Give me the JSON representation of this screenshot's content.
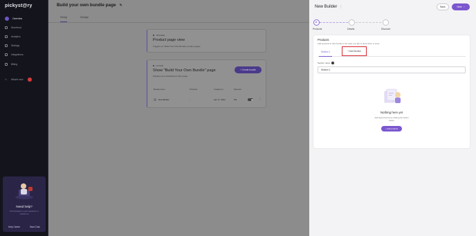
{
  "sidebar": {
    "logo": "pickyst@ry",
    "items": [
      {
        "label": "Overview",
        "icon": "home-icon",
        "active": true
      },
      {
        "label": "Storefront",
        "icon": "store-icon"
      },
      {
        "label": "Analytics",
        "icon": "chart-icon"
      },
      {
        "label": "Settings",
        "icon": "gear-icon"
      },
      {
        "label": "Integrations",
        "icon": "plug-icon"
      },
      {
        "label": "Billing",
        "icon": "card-icon"
      },
      {
        "label": "What's new",
        "icon": "sparkle-icon",
        "badge": true
      }
    ],
    "help": {
      "title": "Need help?",
      "sub": "Find answers to your questions or contact us",
      "link1": "Help Center",
      "link2": "Start Chat"
    }
  },
  "page": {
    "title": "Build your own bundle page",
    "tabs": [
      "Setup",
      "Design"
    ],
    "card1": {
      "tag": "TRIGGER",
      "heading": "Product page view",
      "desc": "Triggers on \"Build Your Own Bundle\" product pages"
    },
    "card2": {
      "tag": "ACTION",
      "heading": "Show \"Build Your Own Bundle\" page",
      "desc": "Displays as a dedicated product page",
      "button": "+ Create bundle"
    },
    "table": {
      "headers": [
        "Bundle name",
        "Products",
        "Created on",
        "Discount"
      ],
      "row": {
        "name": "New Builder",
        "products": "-",
        "created": "Apr 17, 2024",
        "discount": "0%"
      }
    }
  },
  "drawer": {
    "title": "New Builder",
    "back": "Back",
    "next": "Next",
    "steps": [
      "Products",
      "Details",
      "Discount"
    ],
    "panel": {
      "title": "Products",
      "sub": "Add products to this bundle in the order you like to show them in store",
      "tab_section": "Section 1",
      "tab_add": "+ Add Section",
      "field_label": "Section name",
      "field_value": "Section 1",
      "empty_title": "Nothing here yet",
      "empty_sub": "Add desired items by clicking the button below",
      "add_button": "+ Add product"
    }
  },
  "colors": {
    "accent": "#7b57cf",
    "highlight": "#d9282f",
    "sidebar": "#14151c"
  }
}
